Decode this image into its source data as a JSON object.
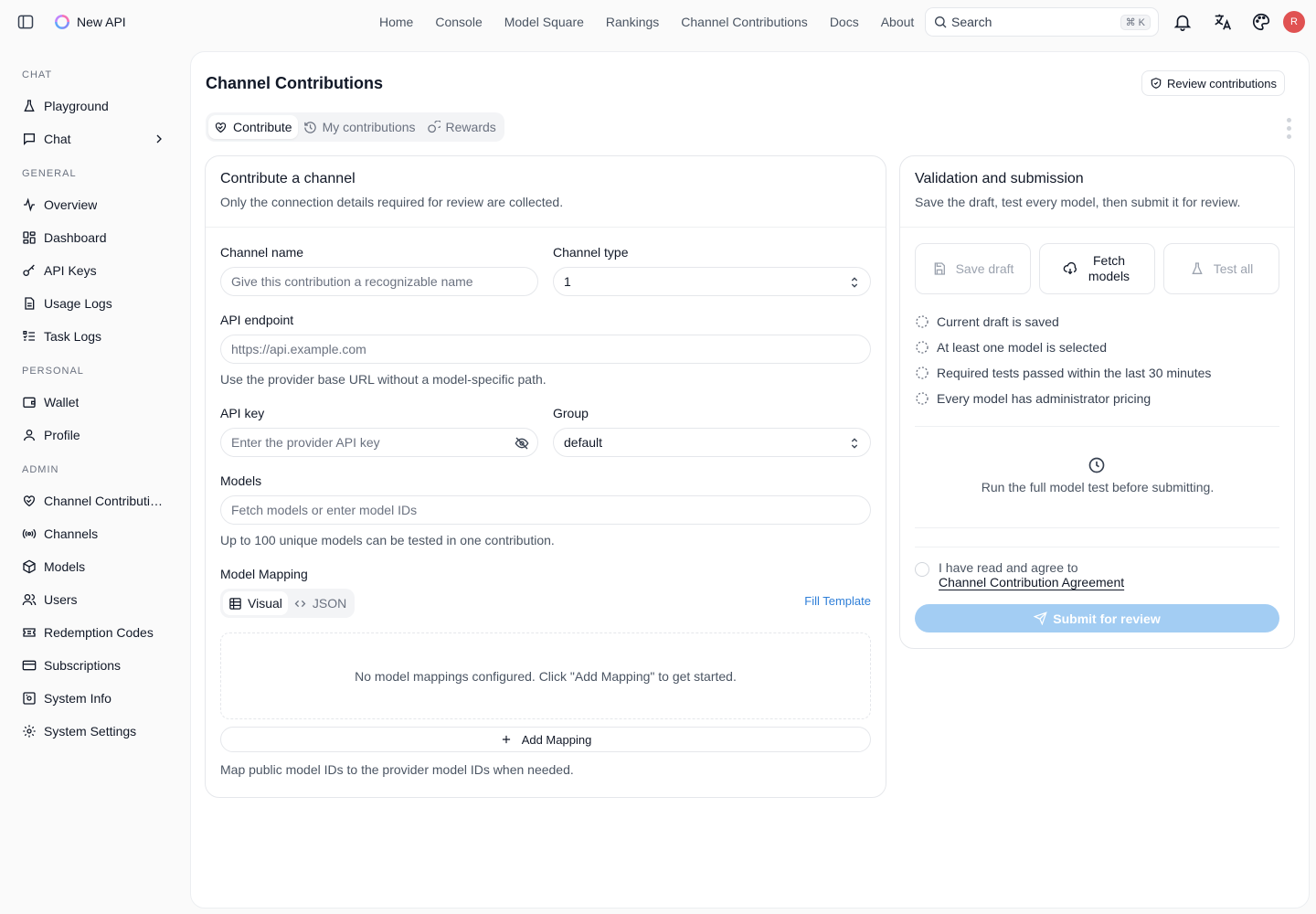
{
  "header": {
    "brand": "New API",
    "nav": [
      "Home",
      "Console",
      "Model Square",
      "Rankings",
      "Channel Contributions",
      "Docs",
      "About"
    ],
    "search_label": "Search",
    "search_shortcut": "⌘ K",
    "avatar_initial": "R"
  },
  "sidebar": {
    "sections": [
      {
        "title": "CHAT",
        "items": [
          "Playground",
          "Chat"
        ]
      },
      {
        "title": "GENERAL",
        "items": [
          "Overview",
          "Dashboard",
          "API Keys",
          "Usage Logs",
          "Task Logs"
        ]
      },
      {
        "title": "PERSONAL",
        "items": [
          "Wallet",
          "Profile"
        ]
      },
      {
        "title": "ADMIN",
        "items": [
          "Channel Contributi…",
          "Channels",
          "Models",
          "Users",
          "Redemption Codes",
          "Subscriptions",
          "System Info",
          "System Settings"
        ]
      }
    ]
  },
  "page": {
    "title": "Channel Contributions",
    "review_button": "Review contributions",
    "tabs": [
      "Contribute",
      "My contributions",
      "Rewards"
    ],
    "active_tab": "Contribute"
  },
  "form": {
    "title": "Contribute a channel",
    "subtitle": "Only the connection details required for review are collected.",
    "channel_name_label": "Channel name",
    "channel_name_placeholder": "Give this contribution a recognizable name",
    "channel_type_label": "Channel type",
    "channel_type_value": "1",
    "endpoint_label": "API endpoint",
    "endpoint_placeholder": "https://api.example.com",
    "endpoint_hint": "Use the provider base URL without a model-specific path.",
    "api_key_label": "API key",
    "api_key_placeholder": "Enter the provider API key",
    "group_label": "Group",
    "group_value": "default",
    "models_label": "Models",
    "models_placeholder": "Fetch models or enter model IDs",
    "models_hint": "Up to 100 unique models can be tested in one contribution.",
    "mapping_label": "Model Mapping",
    "mapping_modes": [
      "Visual",
      "JSON"
    ],
    "fill_template": "Fill Template",
    "mapping_empty": "No model mappings configured. Click \"Add Mapping\" to get started.",
    "add_mapping": "Add Mapping",
    "mapping_hint": "Map public model IDs to the provider model IDs when needed."
  },
  "validation": {
    "title": "Validation and submission",
    "subtitle": "Save the draft, test every model, then submit it for review.",
    "save_draft": "Save draft",
    "fetch_models": "Fetch models",
    "test_all": "Test all",
    "checks": [
      "Current draft is saved",
      "At least one model is selected",
      "Required tests passed within the last 30 minutes",
      "Every model has administrator pricing"
    ],
    "run_notice": "Run the full model test before submitting.",
    "agree_text": "I have read and agree to",
    "agree_link": "Channel Contribution Agreement",
    "submit": "Submit for review"
  },
  "colors": {
    "accent": "#2f7fd8",
    "submit_disabled": "#a3cdf3",
    "avatar": "#e05252"
  }
}
